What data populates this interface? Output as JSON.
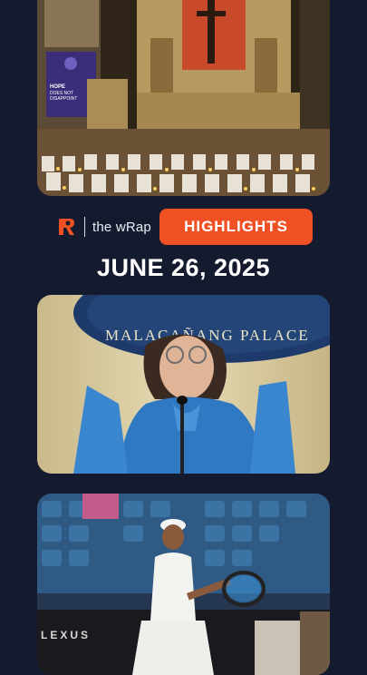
{
  "header": {
    "brand_label": "the wRap",
    "section_label": "HIGHLIGHTS",
    "date": "JUNE 26, 2025"
  },
  "story1": {
    "banner_lines": [
      "HOPE",
      "DOES NOT",
      "DISAPPOINT"
    ]
  },
  "story2": {
    "seal_text": "MALACAÑANG PALACE"
  },
  "story3": {
    "ad_text": "LEXUS"
  },
  "colors": {
    "background": "#151b2e",
    "accent": "#ef5024",
    "text": "#ffffff"
  }
}
